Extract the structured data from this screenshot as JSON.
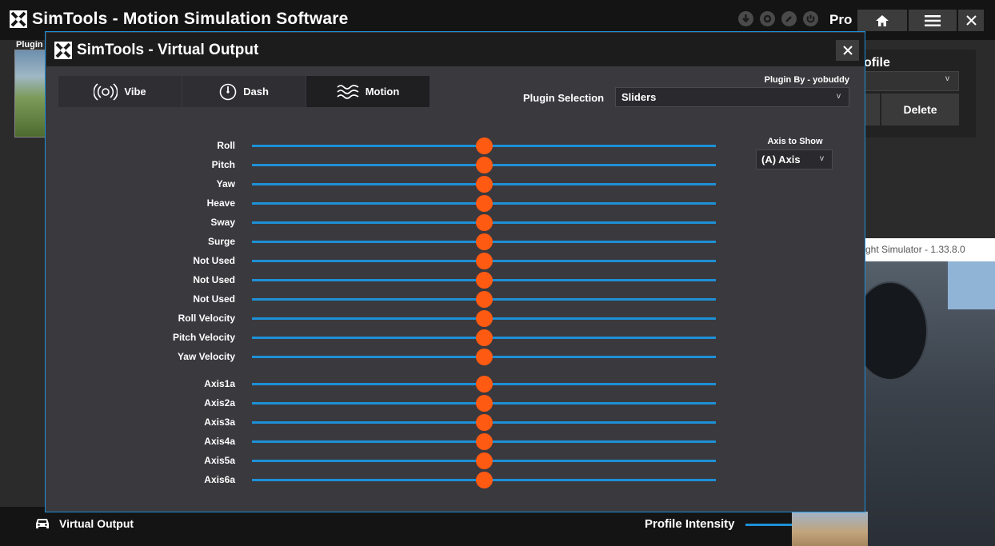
{
  "main": {
    "title": "SimTools - Motion Simulation Software",
    "pro_label": "Pro",
    "plugin_tab": "Plugin",
    "profile_heading": "ofile",
    "delete_label": "Delete",
    "status_icons": [
      "download-icon",
      "gear-icon",
      "wrench-icon",
      "power-icon"
    ]
  },
  "sim_window": {
    "title": "ght Simulator - 1.33.8.0"
  },
  "bottom": {
    "virtual_output": "Virtual Output",
    "profile_intensity": "Profile Intensity"
  },
  "dialog": {
    "title": "SimTools - Virtual Output",
    "tabs": [
      {
        "label": "Vibe",
        "icon": "vibe-icon"
      },
      {
        "label": "Dash",
        "icon": "gauge-icon"
      },
      {
        "label": "Motion",
        "icon": "waves-icon"
      }
    ],
    "active_tab": "Motion",
    "plugin_by": "Plugin By - yobuddy",
    "plugin_selection_label": "Plugin Selection",
    "plugin_selection_value": "Sliders",
    "axis_to_show_label": "Axis to Show",
    "axis_to_show_value": "(A) Axis",
    "sliders": [
      {
        "label": "Roll",
        "value": 0.5
      },
      {
        "label": "Pitch",
        "value": 0.5
      },
      {
        "label": "Yaw",
        "value": 0.5
      },
      {
        "label": "Heave",
        "value": 0.5
      },
      {
        "label": "Sway",
        "value": 0.5
      },
      {
        "label": "Surge",
        "value": 0.5
      },
      {
        "label": "Not Used",
        "value": 0.5
      },
      {
        "label": "Not Used",
        "value": 0.5
      },
      {
        "label": "Not Used",
        "value": 0.5
      },
      {
        "label": "Roll Velocity",
        "value": 0.5
      },
      {
        "label": "Pitch Velocity",
        "value": 0.5
      },
      {
        "label": "Yaw Velocity",
        "value": 0.5
      }
    ],
    "axis_sliders": [
      {
        "label": "Axis1a",
        "value": 0.5
      },
      {
        "label": "Axis2a",
        "value": 0.5
      },
      {
        "label": "Axis3a",
        "value": 0.5
      },
      {
        "label": "Axis4a",
        "value": 0.5
      },
      {
        "label": "Axis5a",
        "value": 0.5
      },
      {
        "label": "Axis6a",
        "value": 0.5
      }
    ]
  },
  "colors": {
    "accent": "#1e90d6",
    "thumb": "#ff5a12",
    "dialog_bg": "#3a393e"
  }
}
